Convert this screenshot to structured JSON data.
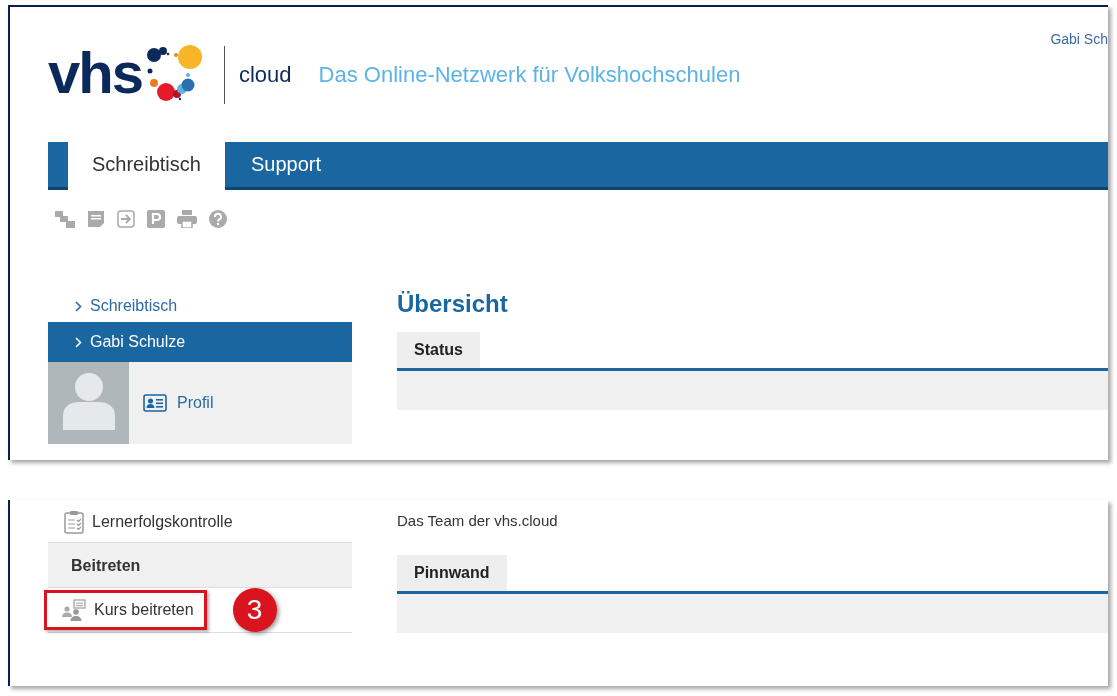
{
  "header": {
    "logo_text": "vhs",
    "product": "cloud",
    "tagline": "Das Online-Netzwerk für Volkshochschulen",
    "user": "Gabi Sch"
  },
  "nav_tabs": [
    {
      "label": "Schreibtisch",
      "selected": true
    },
    {
      "label": "Support",
      "selected": false
    }
  ],
  "sidebar": {
    "items": [
      {
        "label": "Schreibtisch",
        "selected": false
      },
      {
        "label": "Gabi Schulze",
        "selected": true
      }
    ],
    "profile_link": "Profil",
    "lower_items": [
      {
        "kind": "link",
        "label": "Lernerfolgskontrolle"
      },
      {
        "kind": "heading",
        "label": "Beitreten"
      },
      {
        "kind": "link",
        "label": "Kurs beitreten",
        "highlighted": true
      }
    ]
  },
  "annotation": {
    "number": "3"
  },
  "main": {
    "title": "Übersicht",
    "status_tab": "Status",
    "team_text": "Das Team der vhs.cloud",
    "pinboard_tab": "Pinnwand"
  }
}
